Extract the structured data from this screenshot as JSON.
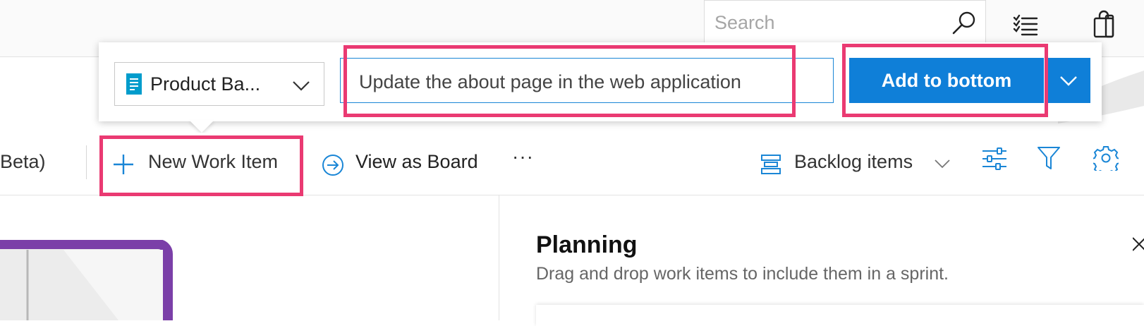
{
  "header": {
    "search": {
      "placeholder": "Search",
      "value": ""
    },
    "icons": [
      "search-icon",
      "checklist-icon",
      "shopping-bag-icon"
    ]
  },
  "quick_add": {
    "work_item_type": "Product Ba...",
    "title_value": "Update the about page in the web application",
    "add_button_label": "Add to bottom",
    "icons": [
      "product-backlog-item-icon",
      "chevron-down-icon"
    ]
  },
  "toolbar": {
    "truncated_label": "Beta)",
    "new_work_item_label": "New Work Item",
    "view_as_board_label": "View as Board",
    "more_label": "···",
    "backlog_level_label": "Backlog items",
    "icons": [
      "plus-icon",
      "arrow-right-circle-icon",
      "backlog-level-icon",
      "view-options-icon",
      "filter-icon",
      "settings-gear-icon"
    ]
  },
  "planning": {
    "title": "Planning",
    "subtitle": "Drag and drop work items to include them in a sprint."
  },
  "colors": {
    "accent": "#0f7fd8",
    "highlight": "#ea3a72",
    "icon_blue": "#1a86d6",
    "work_item_blue": "#009ccc",
    "illustration_purple": "#7b3fa8"
  }
}
